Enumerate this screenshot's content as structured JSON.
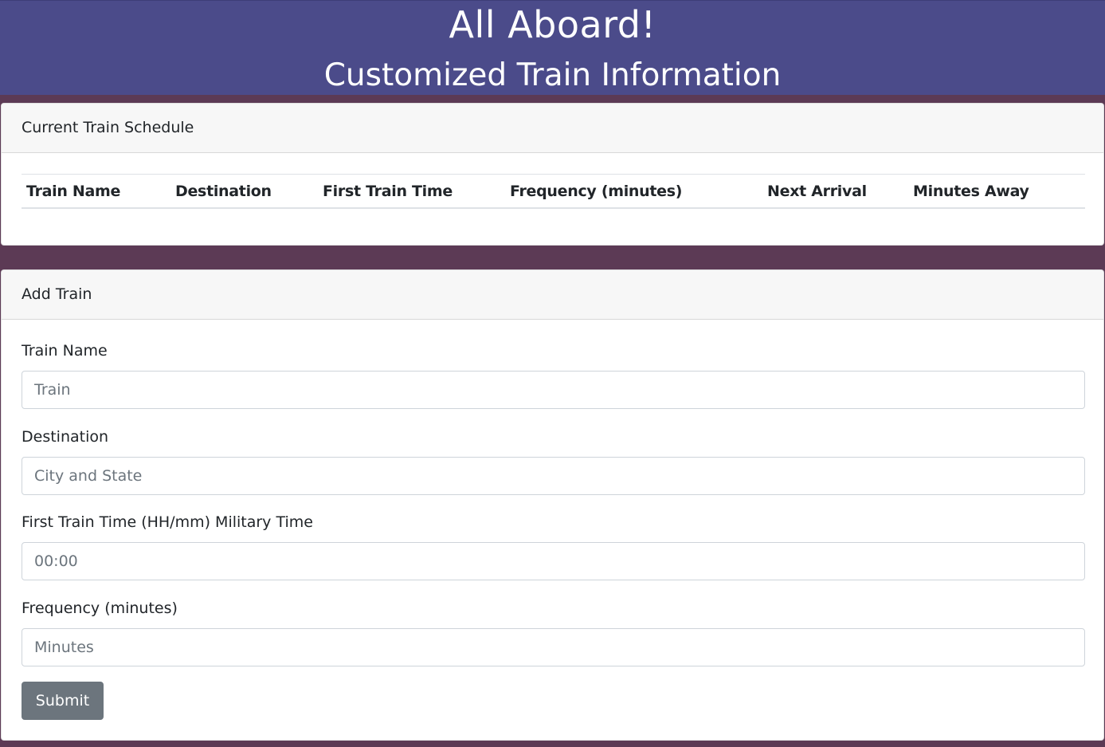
{
  "header": {
    "title": "All Aboard!",
    "subtitle": "Customized Train Information"
  },
  "schedule": {
    "card_title": "Current Train Schedule",
    "columns": [
      "Train Name",
      "Destination",
      "First Train Time",
      "Frequency (minutes)",
      "Next Arrival",
      "Minutes Away"
    ],
    "rows": []
  },
  "add_train": {
    "card_title": "Add Train",
    "fields": [
      {
        "label": "Train Name",
        "placeholder": "Train",
        "value": ""
      },
      {
        "label": "Destination",
        "placeholder": "City and State",
        "value": ""
      },
      {
        "label": "First Train Time (HH/mm) Military Time",
        "placeholder": "00:00",
        "value": ""
      },
      {
        "label": "Frequency (minutes)",
        "placeholder": "Minutes",
        "value": ""
      }
    ],
    "submit_label": "Submit"
  },
  "colors": {
    "page_background": "#5c3a55",
    "header_background": "#4b4b8a",
    "button_background": "#6c757d"
  }
}
